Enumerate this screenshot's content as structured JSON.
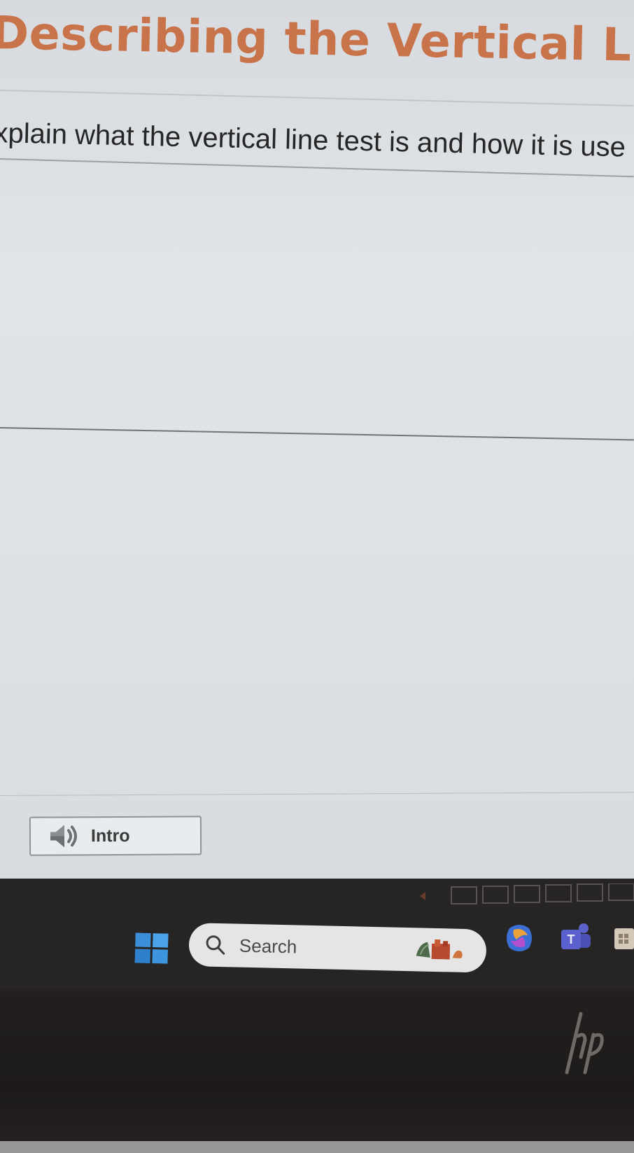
{
  "activity": {
    "title": "Describing the Vertical Line T",
    "prompt": "xplain what the vertical line test is and how it is use",
    "answer_value": ""
  },
  "intro_button": {
    "label": "Intro",
    "icon": "speaker-icon"
  },
  "taskbar": {
    "start_icon": "windows-start-icon",
    "search_placeholder": "Search",
    "search_icon": "search-icon",
    "pinned_icons": [
      "copilot-icon",
      "teams-icon",
      "store-icon"
    ]
  },
  "colors": {
    "title": "#c8734a",
    "prompt_text": "#262626",
    "screen_bg": "#dde2e5",
    "taskbar_bg": "#272424",
    "search_box_bg": "#e4e5e4",
    "start_blue": "#3a8fd8"
  }
}
